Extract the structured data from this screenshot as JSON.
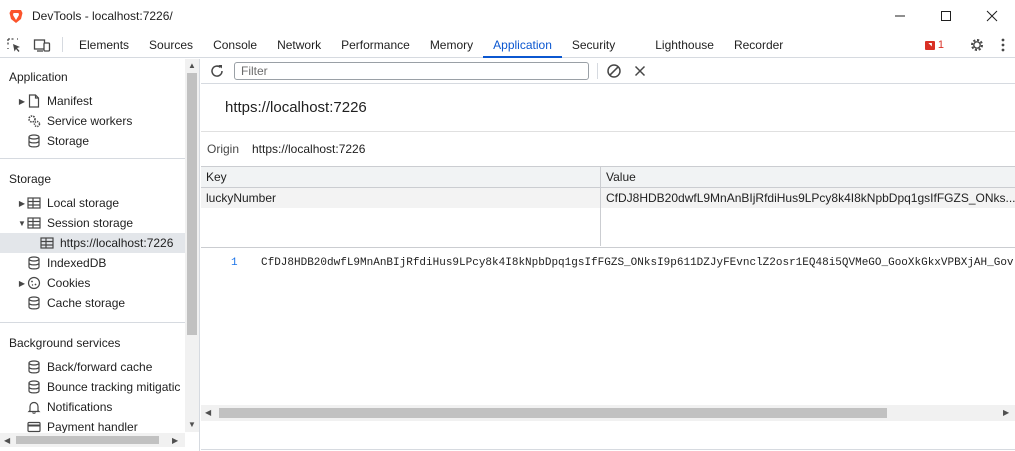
{
  "window": {
    "title": "DevTools - localhost:7226/"
  },
  "tabs": [
    {
      "label": "Elements"
    },
    {
      "label": "Sources"
    },
    {
      "label": "Console"
    },
    {
      "label": "Network"
    },
    {
      "label": "Performance"
    },
    {
      "label": "Memory"
    },
    {
      "label": "Application"
    },
    {
      "label": "Security"
    },
    {
      "label": "Lighthouse"
    },
    {
      "label": "Recorder"
    }
  ],
  "issues": {
    "count": "1"
  },
  "sidebar": {
    "application_header": "Application",
    "application_items": [
      {
        "label": "Manifest",
        "icon": "file-icon"
      },
      {
        "label": "Service workers",
        "icon": "gears-icon"
      },
      {
        "label": "Storage",
        "icon": "database-icon"
      }
    ],
    "storage_header": "Storage",
    "storage_items": [
      {
        "label": "Local storage",
        "icon": "table-icon"
      },
      {
        "label": "Session storage",
        "icon": "table-icon"
      },
      {
        "label": "https://localhost:7226",
        "icon": "table-icon"
      },
      {
        "label": "IndexedDB",
        "icon": "database-icon"
      },
      {
        "label": "Cookies",
        "icon": "cookie-icon"
      },
      {
        "label": "Cache storage",
        "icon": "database-icon"
      }
    ],
    "background_header": "Background services",
    "background_items": [
      {
        "label": "Back/forward cache",
        "icon": "database-icon"
      },
      {
        "label": "Bounce tracking mitigatic",
        "icon": "database-icon"
      },
      {
        "label": "Notifications",
        "icon": "bell-icon"
      },
      {
        "label": "Payment handler",
        "icon": "card-icon"
      }
    ]
  },
  "main": {
    "filter_placeholder": "Filter",
    "origin_title": "https://localhost:7226",
    "origin_label": "Origin",
    "origin_value": "https://localhost:7226",
    "columns": {
      "key": "Key",
      "value": "Value"
    },
    "rows": [
      {
        "key": "luckyNumber",
        "value": "CfDJ8HDB20dwfL9MnAnBIjRfdiHus9LPcy8k4I8kNpbDpq1gsIfFGZS_ONks..."
      }
    ],
    "preview": {
      "line": "1",
      "text": "CfDJ8HDB20dwfL9MnAnBIjRfdiHus9LPcy8k4I8kNpbDpq1gsIfFGZS_ONksI9p611DZJyFEvnclZ2osr1EQ48i5QVMeGO_GooXkGkxVPBXjAH_Gov"
    }
  }
}
